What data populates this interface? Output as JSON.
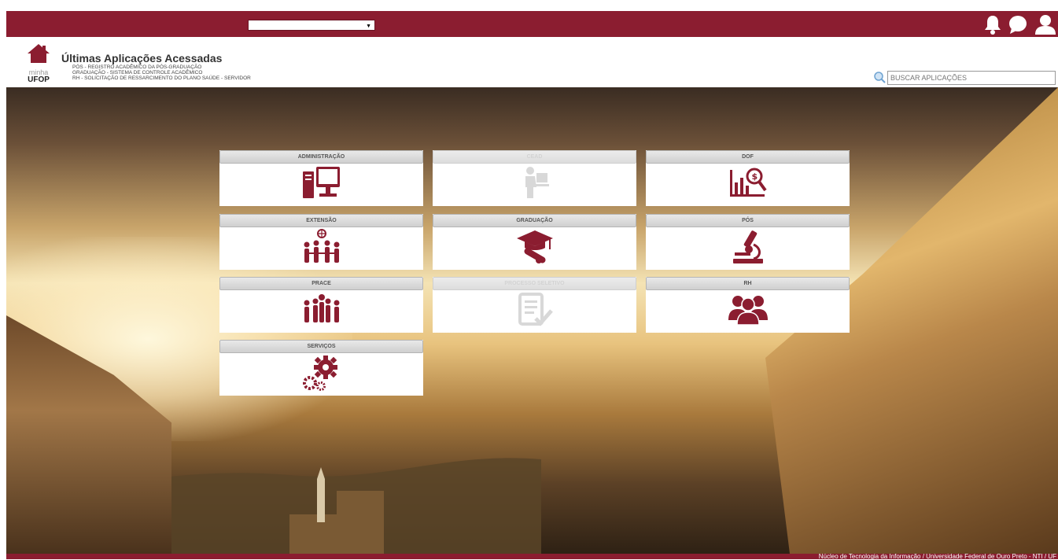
{
  "topbar": {
    "select_value": "",
    "icons": [
      "bell-icon",
      "chat-icon",
      "user-icon"
    ],
    "color": "#8b1d30"
  },
  "logo": {
    "line1": "minha",
    "line2": "UFOP"
  },
  "recent": {
    "title": "Últimas Aplicações Acessadas",
    "items": [
      "PÓS - REGISTRO ACADÊMICO DA PÓS-GRADUAÇÃO",
      "GRADUAÇÃO - SISTEMA DE CONTROLE ACADÊMICO",
      "RH - SOLICITAÇÃO DE RESSARCIMENTO DO PLANO SAÚDE - SERVIDOR"
    ]
  },
  "search": {
    "placeholder": "BUSCAR APLICAÇÕES"
  },
  "tiles": [
    {
      "label": "ADMINISTRAÇÃO",
      "icon": "computer-icon",
      "enabled": true
    },
    {
      "label": "CEAD",
      "icon": "person-at-desk-icon",
      "enabled": false
    },
    {
      "label": "DOF",
      "icon": "finance-chart-icon",
      "enabled": true
    },
    {
      "label": "EXTENSÃO",
      "icon": "community-globe-icon",
      "enabled": true
    },
    {
      "label": "GRADUAÇÃO",
      "icon": "graduation-cap-icon",
      "enabled": true
    },
    {
      "label": "PÓS",
      "icon": "microscope-icon",
      "enabled": true
    },
    {
      "label": "PRACE",
      "icon": "group-people-icon",
      "enabled": true
    },
    {
      "label": "PROCESSO SELETIVO",
      "icon": "checklist-icon",
      "enabled": false
    },
    {
      "label": "RH",
      "icon": "users-icon",
      "enabled": true
    },
    {
      "label": "SERVIÇOS",
      "icon": "gears-icon",
      "enabled": true
    }
  ],
  "footer": {
    "text": "Núcleo de Tecnologia da Informação / Universidade Federal de Ouro Preto - NTI / UF"
  },
  "colors": {
    "brand": "#8b1d30",
    "icon": "#8b1d30",
    "disabled_icon": "#d8d8d8"
  }
}
